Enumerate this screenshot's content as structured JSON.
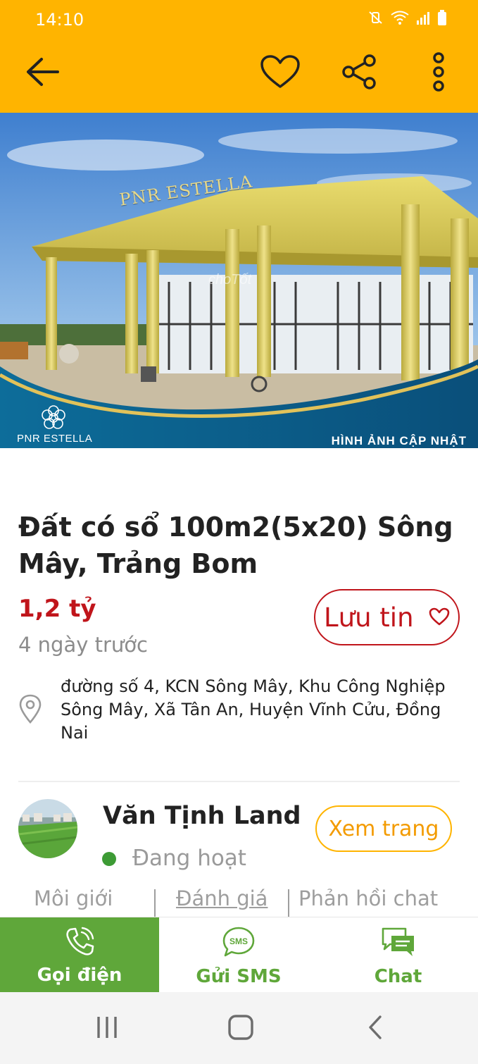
{
  "status_bar": {
    "time": "14:10",
    "icons": [
      "mute-vibrate-icon",
      "wifi-icon",
      "signal-icon",
      "battery-icon"
    ]
  },
  "app_bar": {
    "icons": [
      "back-arrow-icon",
      "heart-outline-icon",
      "share-icon",
      "more-vert-icon"
    ],
    "background_color": "#ffb400"
  },
  "hero": {
    "sign_text": "PNR ESTELLA",
    "watermark": "choTốt",
    "logo_text": "PNR ESTELLA",
    "caption": "HÌNH ẢNH CẬP NHẬT"
  },
  "listing": {
    "title": "Đất có sổ 100m2(5x20) Sông Mây, Trảng Bom",
    "price": "1,2 tỷ",
    "posted": "4 ngày trước",
    "save_label": "Lưu tin",
    "address": "đường số 4, KCN Sông Mây, Khu Công Nghiệp Sông Mây, Xã Tân An, Huyện Vĩnh Cửu, Đồng Nai"
  },
  "seller": {
    "name": "Văn Tịnh Land",
    "status": "Đang hoạt",
    "view_label": "Xem trang",
    "stats": [
      "Môi giới",
      "Đánh giá",
      "Phản hồi chat"
    ]
  },
  "actions": {
    "call": "Gọi điện",
    "sms": "Gửi SMS",
    "chat": "Chat"
  },
  "colors": {
    "brand_yellow": "#ffb400",
    "price_red": "#c0151b",
    "action_green": "#5fa73a",
    "online_green": "#3d9b35"
  }
}
